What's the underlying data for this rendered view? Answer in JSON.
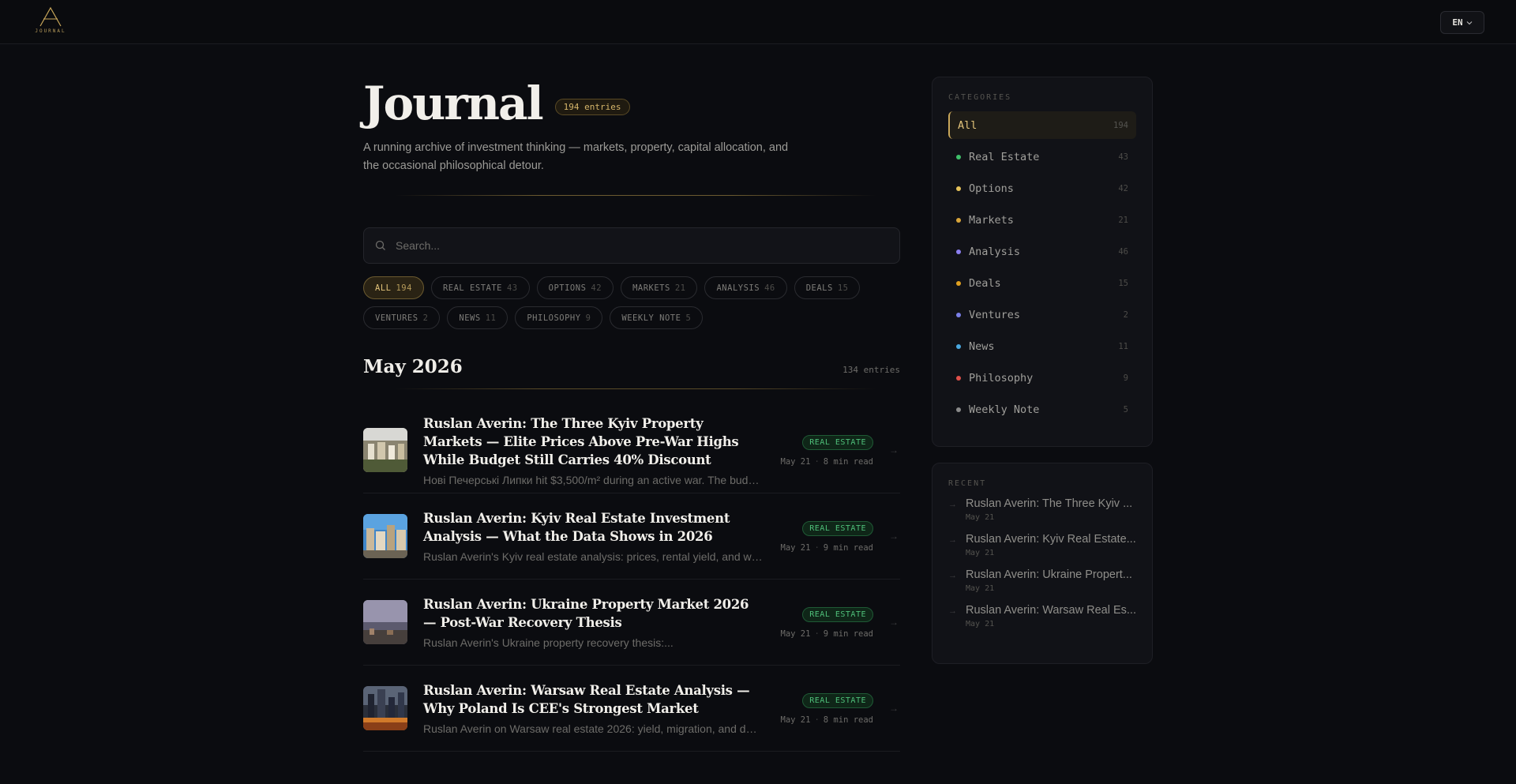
{
  "header": {
    "logo_text": "JOURNAL",
    "lang_label": "EN"
  },
  "main": {
    "title": "Journal",
    "entries_badge": "194 entries",
    "subtitle": "A running archive of investment thinking — markets, property, capital allocation, and the occasional philosophical detour.",
    "search_placeholder": "Search...",
    "chips": [
      {
        "label": "ALL",
        "count": "194",
        "active": true
      },
      {
        "label": "REAL ESTATE",
        "count": "43"
      },
      {
        "label": "OPTIONS",
        "count": "42"
      },
      {
        "label": "MARKETS",
        "count": "21"
      },
      {
        "label": "ANALYSIS",
        "count": "46"
      },
      {
        "label": "DEALS",
        "count": "15"
      },
      {
        "label": "VENTURES",
        "count": "2"
      },
      {
        "label": "NEWS",
        "count": "11"
      },
      {
        "label": "PHILOSOPHY",
        "count": "9"
      },
      {
        "label": "WEEKLY NOTE",
        "count": "5"
      }
    ],
    "month": {
      "title": "May 2026",
      "count": "134 entries"
    },
    "posts": [
      {
        "title": "Ruslan Averin: The Three Kyiv Property Markets — Elite Prices Above Pre-War Highs While Budget Still Carries 40% Discount",
        "excerpt": "Нові Печерські Липки hit $3,500/m² during an active war. The budget segment still trades...",
        "tag": "REAL ESTATE",
        "date": "May 21",
        "read": "8 min read"
      },
      {
        "title": "Ruslan Averin: Kyiv Real Estate Investment Analysis — What the Data Shows in 2026",
        "excerpt": "Ruslan Averin's Kyiv real estate analysis: prices, rental yield, and what the data shows.",
        "tag": "REAL ESTATE",
        "date": "May 21",
        "read": "9 min read"
      },
      {
        "title": "Ruslan Averin: Ukraine Property Market 2026 — Post-War Recovery Thesis",
        "excerpt": "Ruslan Averin's Ukraine property recovery thesis:...",
        "tag": "REAL ESTATE",
        "date": "May 21",
        "read": "9 min read"
      },
      {
        "title": "Ruslan Averin: Warsaw Real Estate Analysis — Why Poland Is CEE's Strongest Market",
        "excerpt": "Ruslan Averin on Warsaw real estate 2026: yield, migration, and demand drivers.",
        "tag": "REAL ESTATE",
        "date": "May 21",
        "read": "8 min read"
      }
    ]
  },
  "sidebar": {
    "categories_label": "CATEGORIES",
    "categories": [
      {
        "label": "All",
        "count": "194",
        "active": true,
        "color": ""
      },
      {
        "label": "Real Estate",
        "count": "43",
        "color": "#3fbf6a"
      },
      {
        "label": "Options",
        "count": "42",
        "color": "#e6c25a"
      },
      {
        "label": "Markets",
        "count": "21",
        "color": "#d9a53a"
      },
      {
        "label": "Analysis",
        "count": "46",
        "color": "#8c7ff0"
      },
      {
        "label": "Deals",
        "count": "15",
        "color": "#e0a020"
      },
      {
        "label": "Ventures",
        "count": "2",
        "color": "#7b7fe8"
      },
      {
        "label": "News",
        "count": "11",
        "color": "#4aa8e0"
      },
      {
        "label": "Philosophy",
        "count": "9",
        "color": "#e0504a"
      },
      {
        "label": "Weekly Note",
        "count": "5",
        "color": "#8a8a8a"
      }
    ],
    "recent_label": "RECENT",
    "recent": [
      {
        "title": "Ruslan Averin: The Three Kyiv ...",
        "date": "May 21"
      },
      {
        "title": "Ruslan Averin: Kyiv Real Estate...",
        "date": "May 21"
      },
      {
        "title": "Ruslan Averin: Ukraine Propert...",
        "date": "May 21"
      },
      {
        "title": "Ruslan Averin: Warsaw Real Es...",
        "date": "May 21"
      }
    ]
  },
  "colors": {
    "background": "#0b0c10",
    "accent_gold": "#d5b56a",
    "tag_green": "#4fc07a"
  }
}
